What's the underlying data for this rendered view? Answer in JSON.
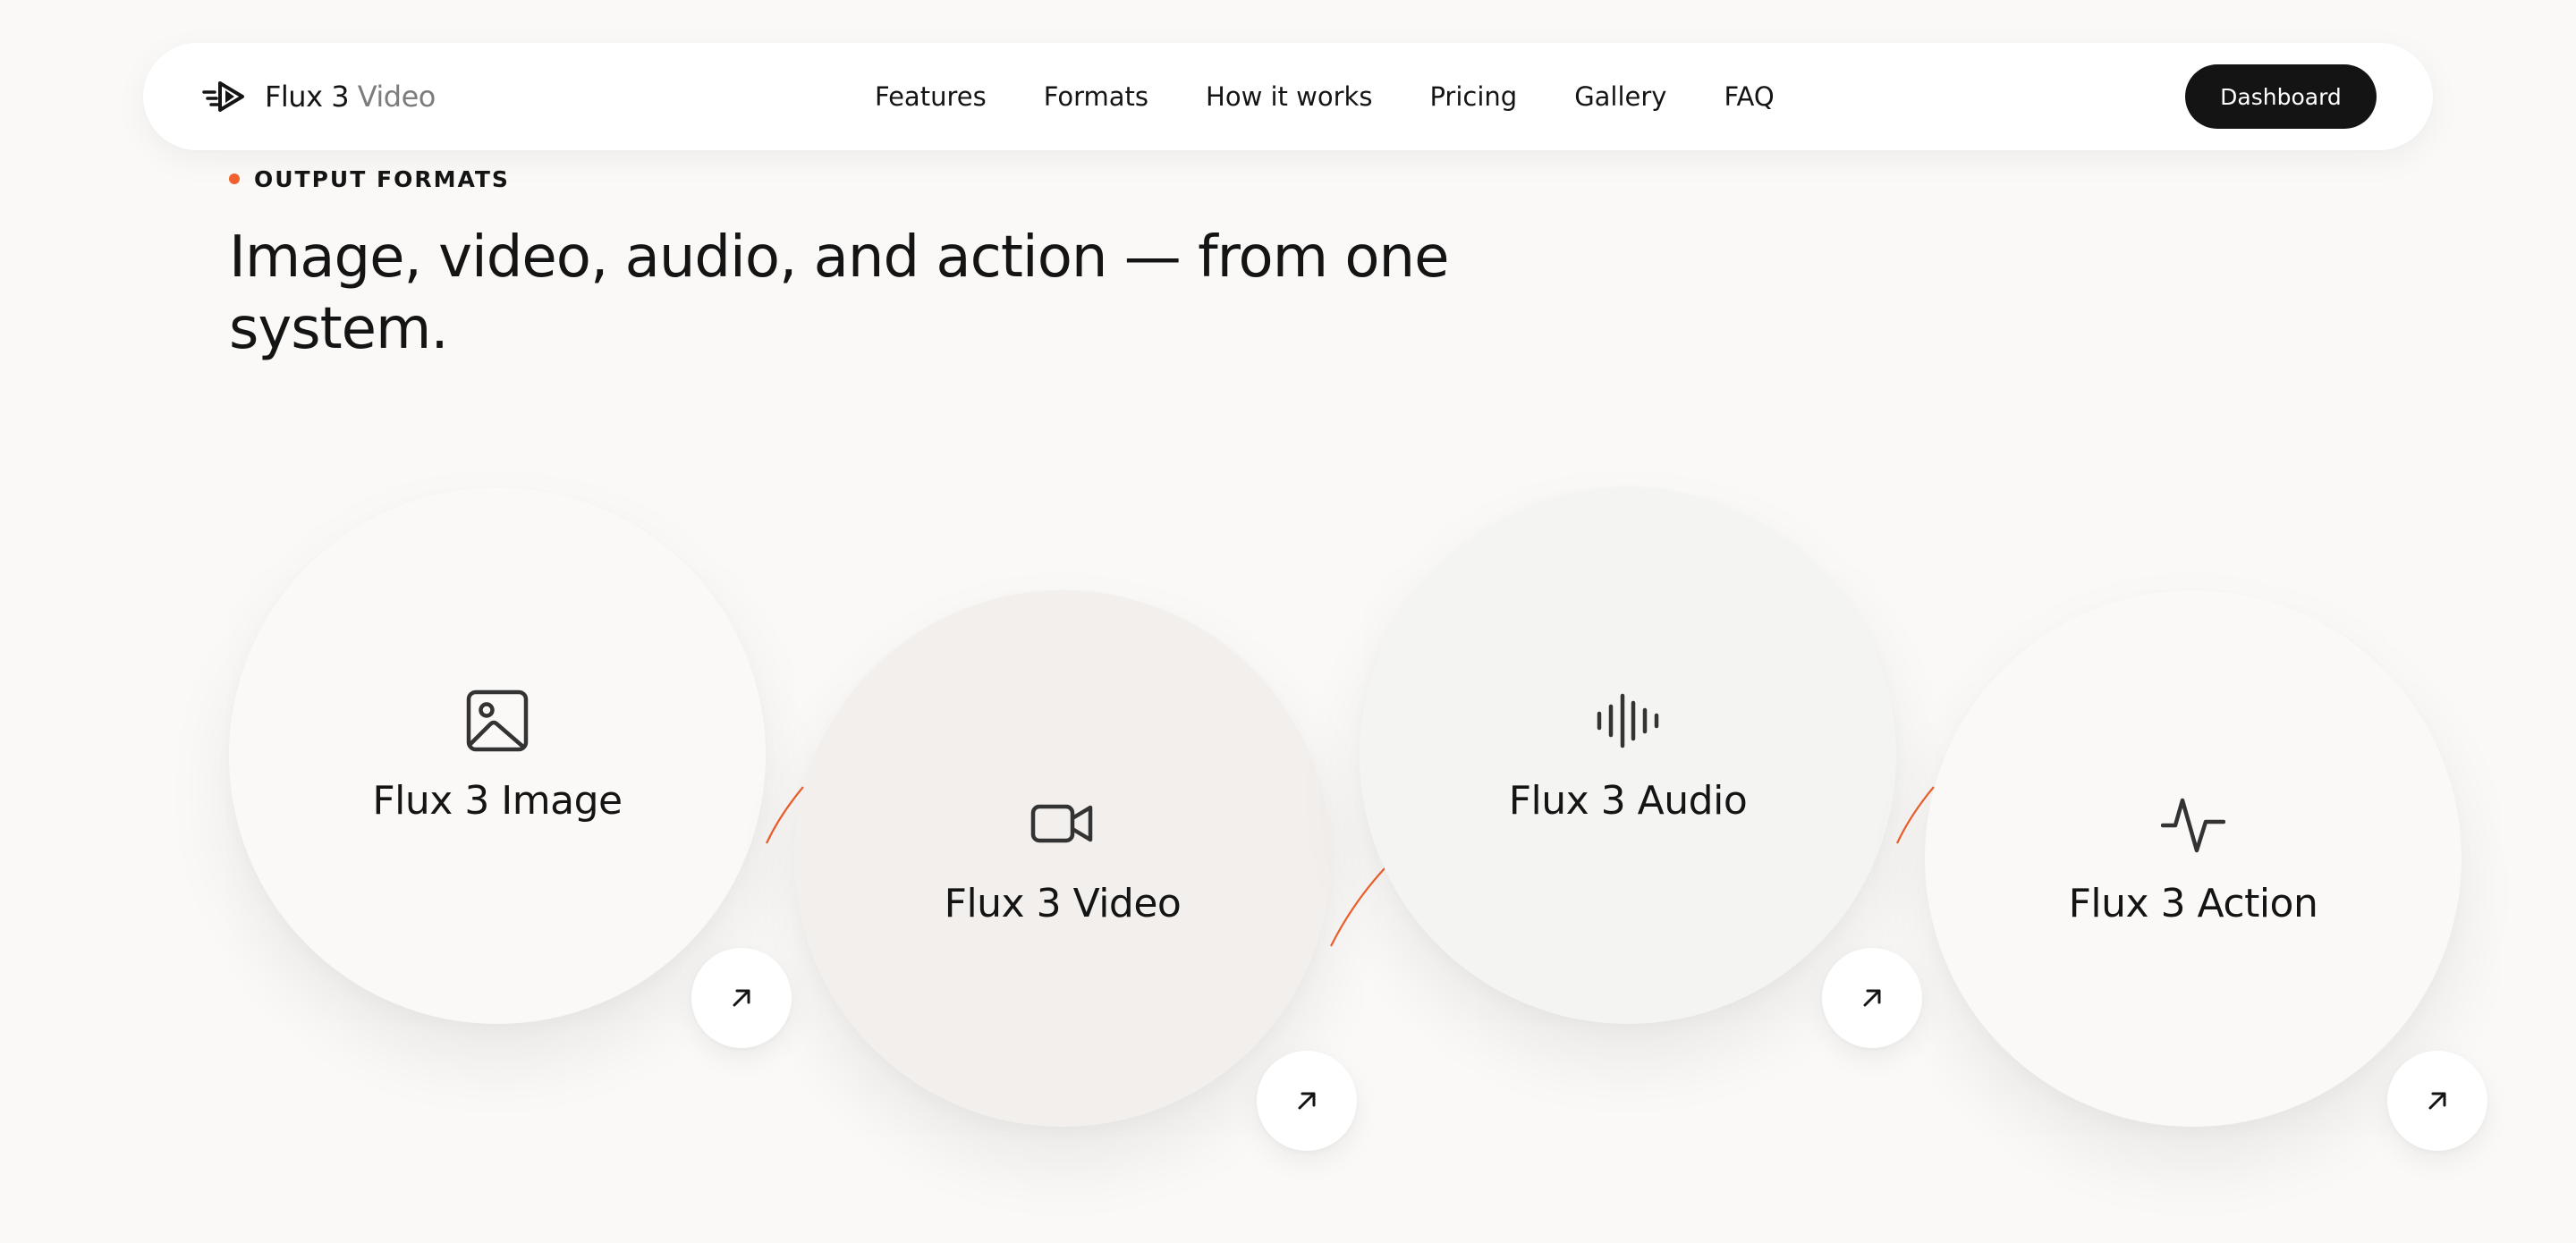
{
  "nav": {
    "brand_name": "Flux 3",
    "brand_suffix": "Video",
    "links": [
      "Features",
      "Formats",
      "How it works",
      "Pricing",
      "Gallery",
      "FAQ"
    ],
    "dashboard_label": "Dashboard"
  },
  "section": {
    "eyebrow": "OUTPUT FORMATS",
    "headline_line1": "Image, video, audio, and action — from one",
    "headline_line2": "system."
  },
  "formats": [
    {
      "label": "Flux 3 Image",
      "icon": "image-icon"
    },
    {
      "label": "Flux 3 Video",
      "icon": "video-camera-icon"
    },
    {
      "label": "Flux 3 Audio",
      "icon": "audio-waveform-icon"
    },
    {
      "label": "Flux 3 Action",
      "icon": "activity-pulse-icon"
    }
  ],
  "colors": {
    "accent": "#f0612e",
    "ink": "#141414",
    "muted": "#7c7c7c",
    "background": "#faf9f7"
  }
}
